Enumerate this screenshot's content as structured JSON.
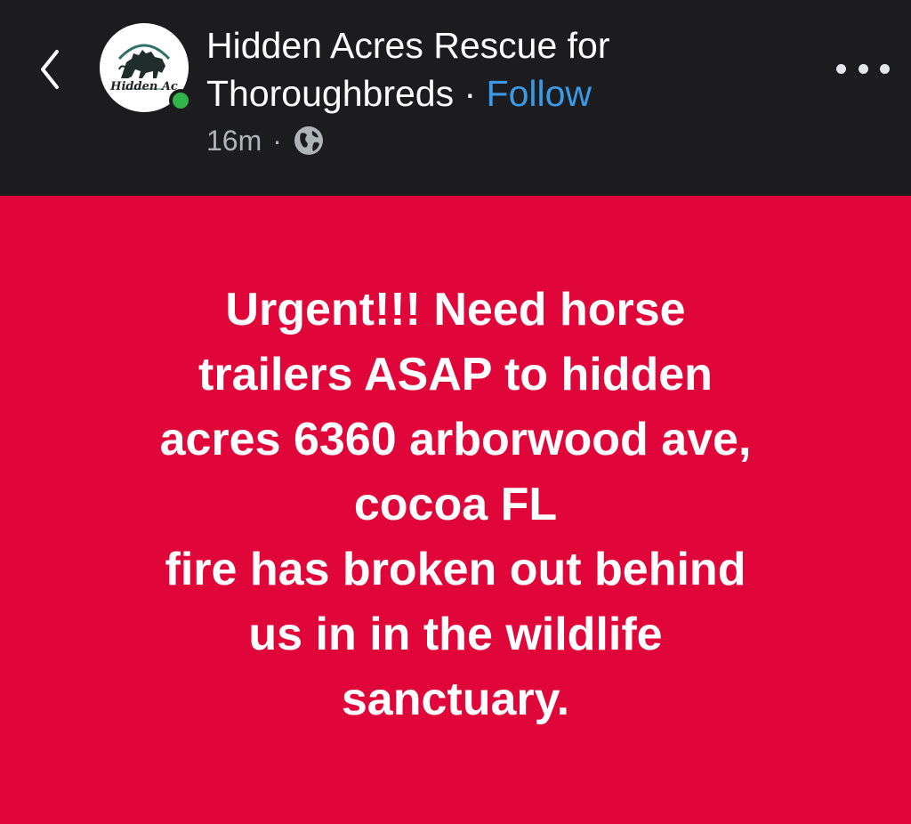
{
  "header": {
    "back_icon": "chevron-left-icon",
    "page_name_line1": "Hidden Acres Rescue for",
    "page_name_line2": "Thoroughbreds",
    "separator": "·",
    "follow_label": "Follow",
    "time_ago": "16m",
    "meta_separator": "·",
    "audience_icon": "globe-icon",
    "more_icon": "more-options-icon",
    "avatar_text": "Hidden Ac",
    "online_status_color": "#31b44b",
    "follow_color": "#3a9ae8"
  },
  "post": {
    "background_color": "#e1063a",
    "lines": [
      "Urgent!!! Need horse",
      "trailers ASAP to hidden",
      "acres 6360 arborwood ave,",
      "cocoa FL",
      "fire has broken out behind",
      "us in in the wildlife",
      "sanctuary."
    ]
  }
}
